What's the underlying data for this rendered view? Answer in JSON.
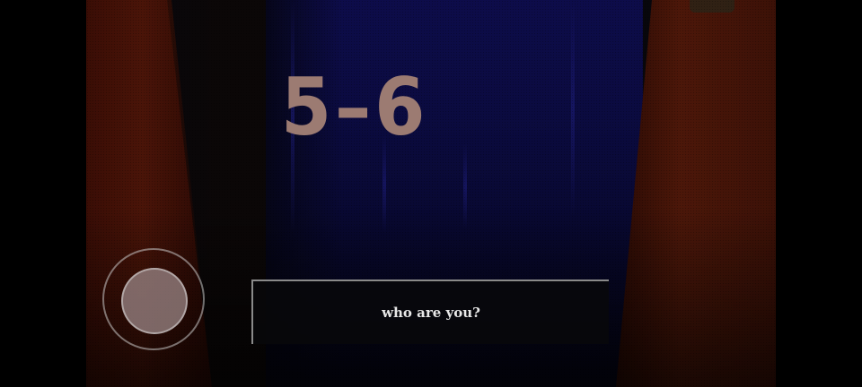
{
  "hud": {
    "level_number": "5–6"
  },
  "dialogue": {
    "text": "who are you?"
  },
  "controls": {
    "joystick": "virtual-joystick"
  },
  "colors": {
    "level_text": "#9c7b72",
    "back_wall": "#0d0c4a",
    "side_walls": "#4a1408"
  }
}
